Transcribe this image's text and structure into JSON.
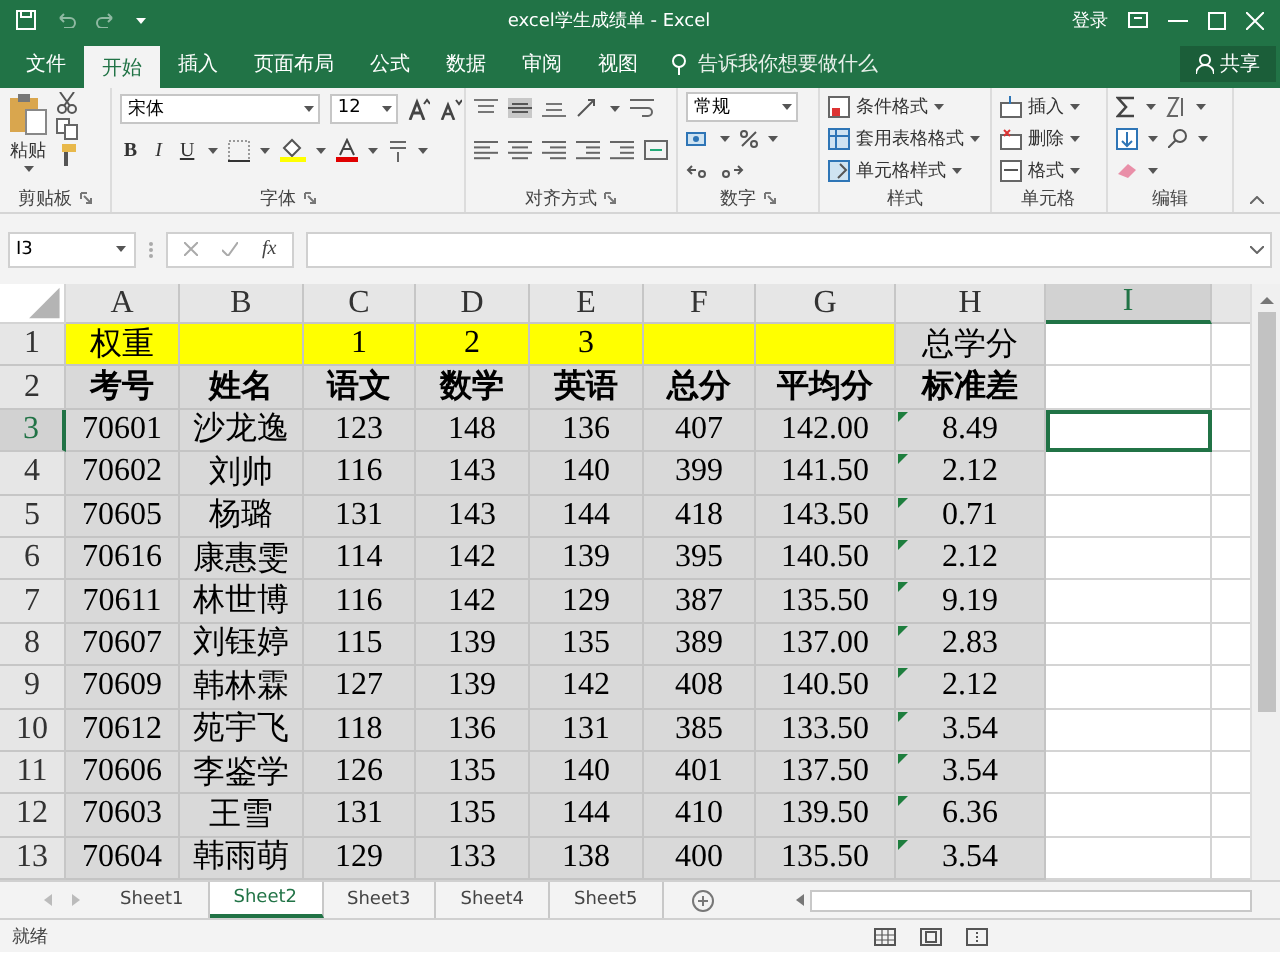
{
  "window": {
    "title": "excel学生成绩单 - Excel",
    "account": "登录"
  },
  "menu_tabs": [
    {
      "label": "文件",
      "selected": false
    },
    {
      "label": "开始",
      "selected": true
    },
    {
      "label": "插入",
      "selected": false
    },
    {
      "label": "页面布局",
      "selected": false
    },
    {
      "label": "公式",
      "selected": false
    },
    {
      "label": "数据",
      "selected": false
    },
    {
      "label": "审阅",
      "selected": false
    },
    {
      "label": "视图",
      "selected": false
    }
  ],
  "tell_me": {
    "placeholder": "告诉我你想要做什么"
  },
  "share_button": "共享",
  "ribbon": {
    "clipboard": {
      "paste": "粘贴",
      "label": "剪贴板"
    },
    "font": {
      "name": "宋体",
      "size": "12",
      "styles": [
        "B",
        "I",
        "U"
      ],
      "label": "字体"
    },
    "alignment": {
      "label": "对齐方式"
    },
    "number": {
      "format": "常规",
      "label": "数字"
    },
    "styles": {
      "items": [
        "条件格式",
        "套用表格格式",
        "单元格样式"
      ],
      "label": "样式"
    },
    "cells": {
      "items": [
        "插入",
        "删除",
        "格式"
      ],
      "label": "单元格"
    },
    "editing": {
      "label": "编辑"
    }
  },
  "formula_bar": {
    "name_box": "I3",
    "function_button": "fx"
  },
  "sheet": {
    "columns": [
      {
        "label": "A",
        "selected": false
      },
      {
        "label": "B",
        "selected": false
      },
      {
        "label": "C",
        "selected": false
      },
      {
        "label": "D",
        "selected": false
      },
      {
        "label": "E",
        "selected": false
      },
      {
        "label": "F",
        "selected": false
      },
      {
        "label": "G",
        "selected": false
      },
      {
        "label": "H",
        "selected": false
      },
      {
        "label": "I",
        "selected": true
      }
    ],
    "rows": [
      {
        "number": "1",
        "kind": "weights",
        "selected": false,
        "cells": [
          "权重",
          null,
          "1",
          "2",
          "3",
          null,
          null,
          "总学分"
        ]
      },
      {
        "number": "2",
        "kind": "header",
        "selected": false,
        "cells": [
          "考号",
          "姓名",
          "语文",
          "数学",
          "英语",
          "总分",
          "平均分",
          "标准差"
        ]
      },
      {
        "number": "3",
        "kind": "data",
        "selected": true,
        "cells": [
          "70601",
          "沙龙逸",
          "123",
          "148",
          "136",
          "407",
          "142.00",
          "8.49"
        ]
      },
      {
        "number": "4",
        "kind": "data",
        "selected": false,
        "cells": [
          "70602",
          "刘帅",
          "116",
          "143",
          "140",
          "399",
          "141.50",
          "2.12"
        ]
      },
      {
        "number": "5",
        "kind": "data",
        "selected": false,
        "cells": [
          "70605",
          "杨璐",
          "131",
          "143",
          "144",
          "418",
          "143.50",
          "0.71"
        ]
      },
      {
        "number": "6",
        "kind": "data",
        "selected": false,
        "cells": [
          "70616",
          "康惠雯",
          "114",
          "142",
          "139",
          "395",
          "140.50",
          "2.12"
        ]
      },
      {
        "number": "7",
        "kind": "data",
        "selected": false,
        "cells": [
          "70611",
          "林世博",
          "116",
          "142",
          "129",
          "387",
          "135.50",
          "9.19"
        ]
      },
      {
        "number": "8",
        "kind": "data",
        "selected": false,
        "cells": [
          "70607",
          "刘钰婷",
          "115",
          "139",
          "135",
          "389",
          "137.00",
          "2.83"
        ]
      },
      {
        "number": "9",
        "kind": "data",
        "selected": false,
        "cells": [
          "70609",
          "韩林霖",
          "127",
          "139",
          "142",
          "408",
          "140.50",
          "2.12"
        ]
      },
      {
        "number": "10",
        "kind": "data",
        "selected": false,
        "cells": [
          "70612",
          "苑宇飞",
          "118",
          "136",
          "131",
          "385",
          "133.50",
          "3.54"
        ]
      },
      {
        "number": "11",
        "kind": "data",
        "selected": false,
        "cells": [
          "70606",
          "李鉴学",
          "126",
          "135",
          "140",
          "401",
          "137.50",
          "3.54"
        ]
      },
      {
        "number": "12",
        "kind": "data",
        "selected": false,
        "cells": [
          "70603",
          "王雪",
          "131",
          "135",
          "144",
          "410",
          "139.50",
          "6.36"
        ]
      },
      {
        "number": "13",
        "kind": "data",
        "selected": false,
        "cells": [
          "70604",
          "韩雨萌",
          "129",
          "133",
          "138",
          "400",
          "135.50",
          "3.54"
        ]
      }
    ]
  },
  "sheet_tabs": [
    {
      "label": "Sheet1",
      "selected": false
    },
    {
      "label": "Sheet2",
      "selected": true
    },
    {
      "label": "Sheet3",
      "selected": false
    },
    {
      "label": "Sheet4",
      "selected": false
    },
    {
      "label": "Sheet5",
      "selected": false
    }
  ],
  "status_bar": {
    "text": "就绪"
  }
}
